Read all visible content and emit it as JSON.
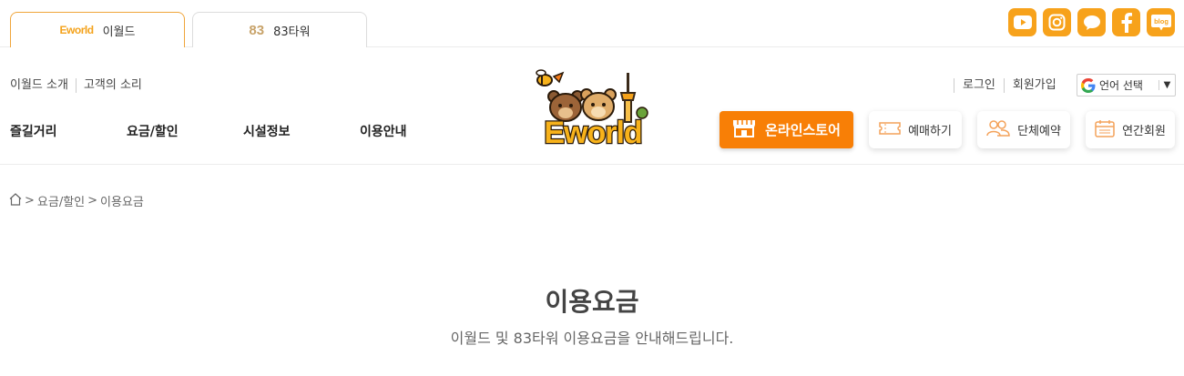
{
  "site_tabs": [
    {
      "logo_text": "Eworld",
      "label": "이월드",
      "active": true
    },
    {
      "logo_text": "83",
      "label": "83타워",
      "active": false
    }
  ],
  "socials": [
    "youtube-icon",
    "instagram-icon",
    "talk-icon",
    "facebook-icon",
    "blog-icon"
  ],
  "social_blog_text": "blog",
  "util_left": [
    "이월드 소개",
    "고객의 소리"
  ],
  "main_nav": [
    "즐길거리",
    "요금/할인",
    "시설정보",
    "이용안내"
  ],
  "logo": {
    "text": "Eworld"
  },
  "util_right": [
    "로그인",
    "회원가입"
  ],
  "language": {
    "label": "언어 선택",
    "arrow": "▼"
  },
  "actions": {
    "store": "온라인스토어",
    "ticket": "예매하기",
    "group": "단체예약",
    "annual": "연간회원"
  },
  "breadcrumb": {
    "sep1": ">",
    "level1": "요금/할인",
    "sep2": ">",
    "level2": "이용요금"
  },
  "page": {
    "title": "이용요금",
    "subtitle": "이월드 및 83타워 이용요금을 안내해드립니다."
  },
  "colors": {
    "accent": "#f7a21b",
    "store": "#f87f06"
  }
}
